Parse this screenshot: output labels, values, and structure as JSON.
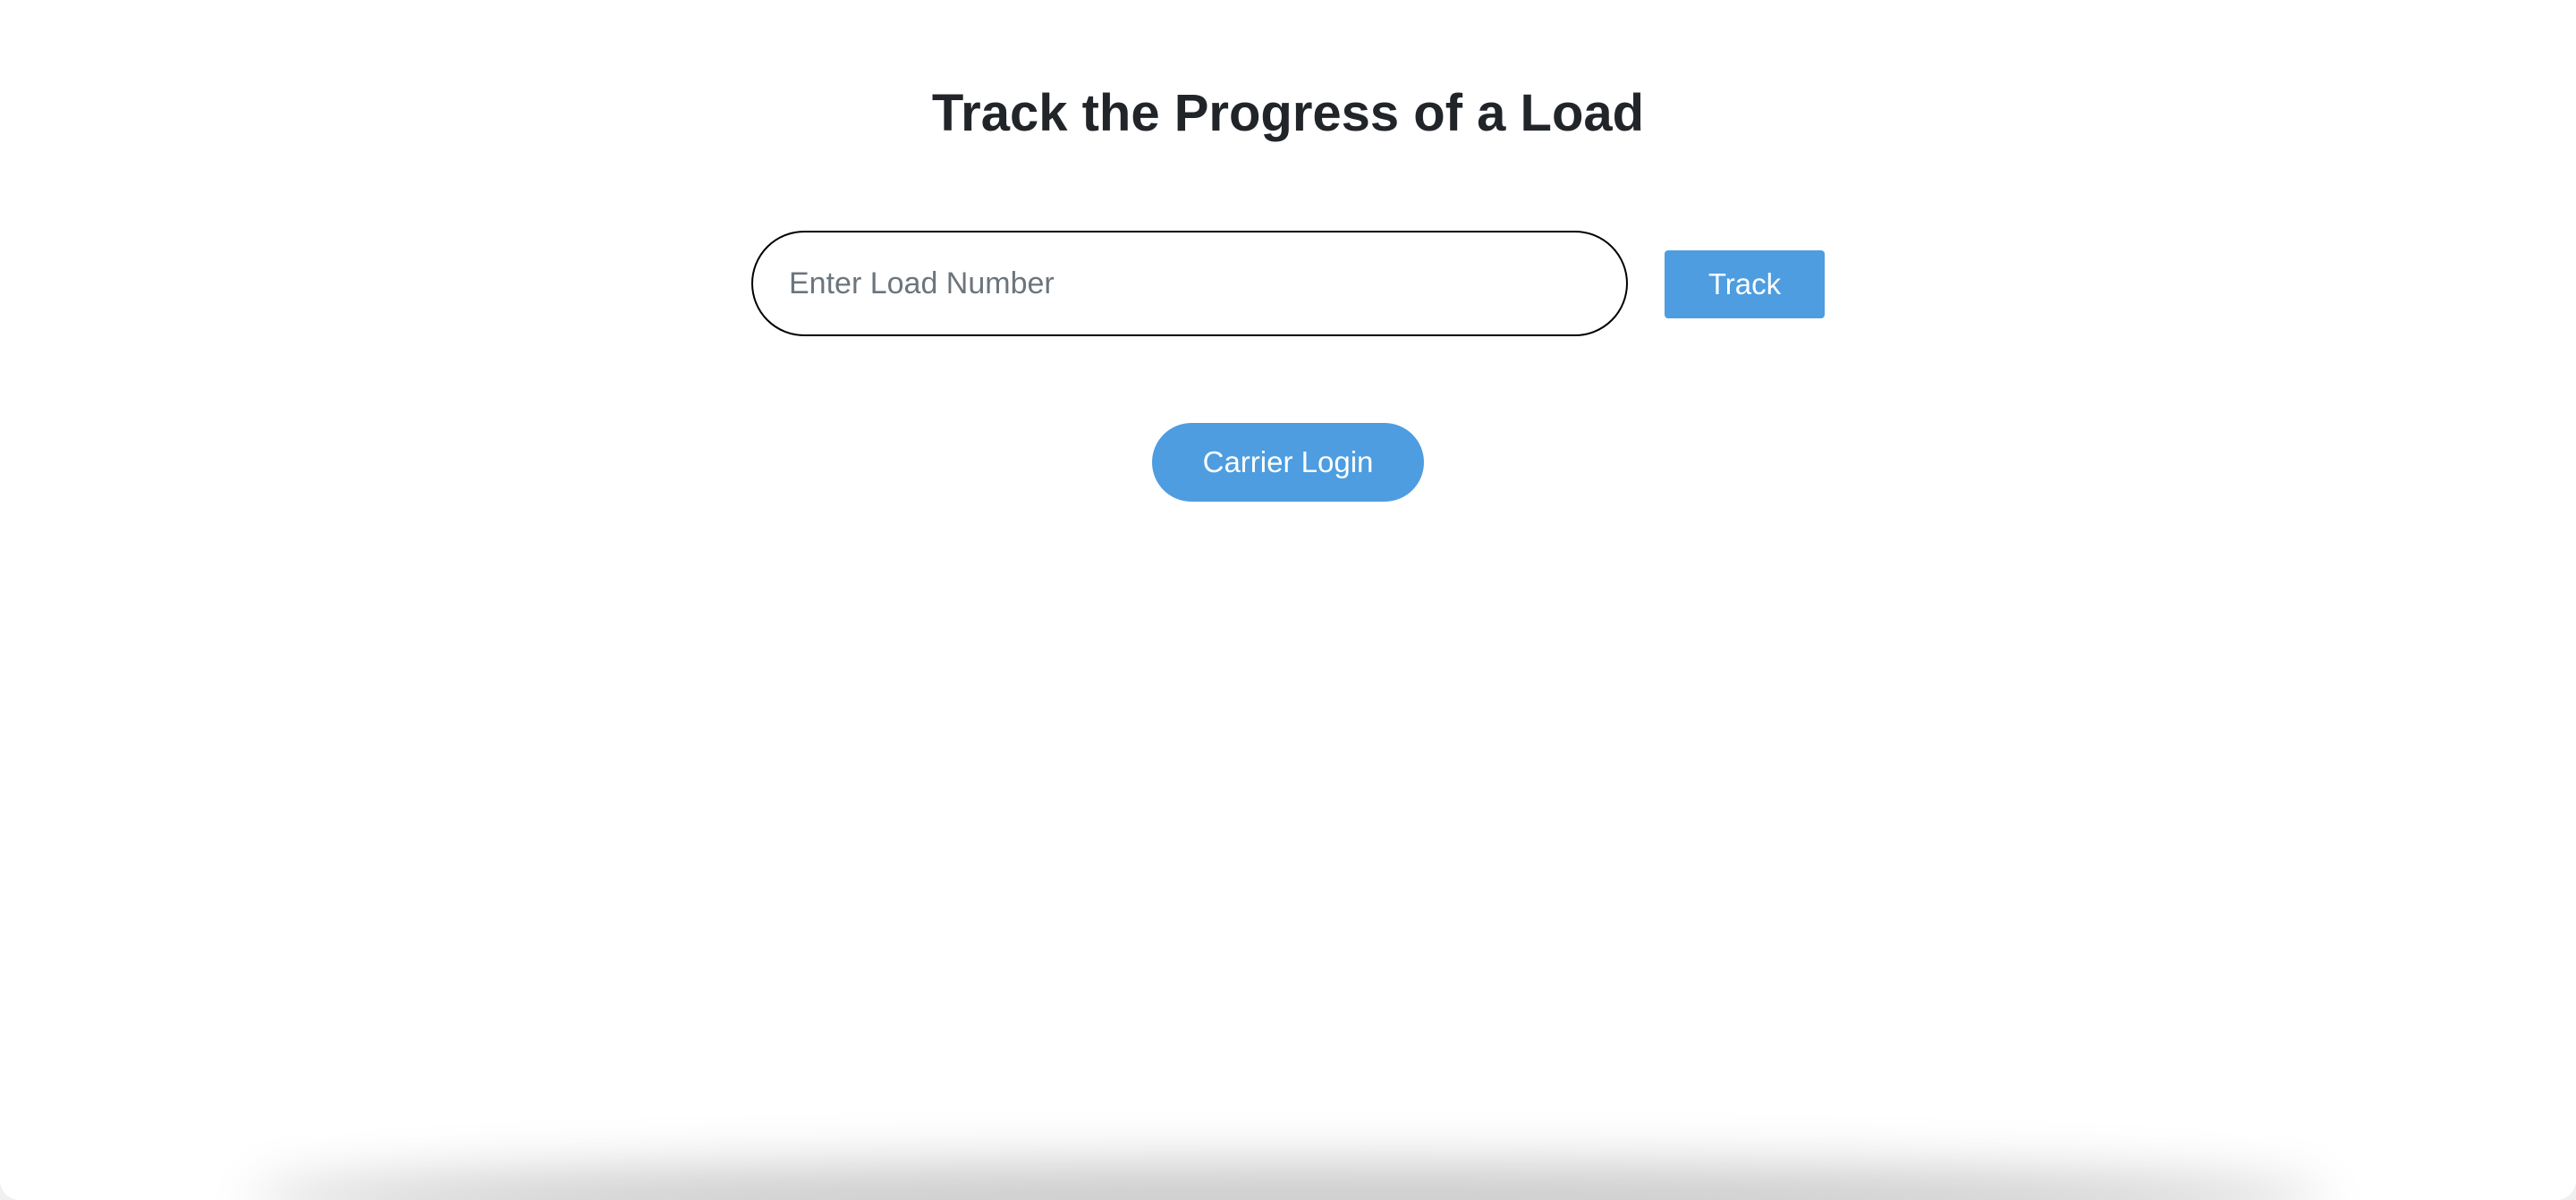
{
  "page": {
    "title": "Track the Progress of a Load"
  },
  "track_form": {
    "input_placeholder": "Enter Load Number",
    "input_value": "",
    "track_label": "Track"
  },
  "carrier": {
    "login_label": "Carrier Login"
  },
  "colors": {
    "accent": "#4d9de0",
    "title_text": "#212529",
    "background": "#ffffff"
  }
}
